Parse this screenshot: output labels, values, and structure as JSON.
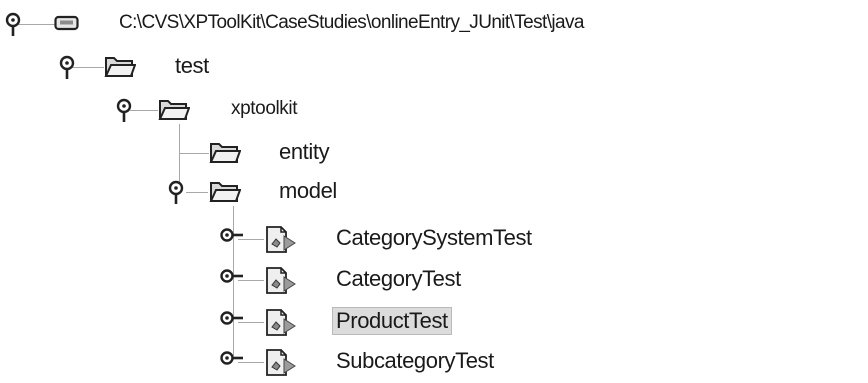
{
  "tree": {
    "root": {
      "label": "C:\\CVS\\XPToolKit\\CaseStudies\\onlineEntry_JUnit\\Test\\java",
      "icon": "drive-icon",
      "state": "expanded"
    },
    "nodes": [
      {
        "label": "test",
        "icon": "folder-icon",
        "state": "expanded"
      },
      {
        "label": "xptoolkit",
        "icon": "folder-icon",
        "state": "expanded"
      },
      {
        "label": "entity",
        "icon": "folder-icon",
        "state": "leaf"
      },
      {
        "label": "model",
        "icon": "folder-icon",
        "state": "expanded"
      },
      {
        "label": "CategorySystemTest",
        "icon": "test-class-icon",
        "state": "collapsed"
      },
      {
        "label": "CategoryTest",
        "icon": "test-class-icon",
        "state": "collapsed"
      },
      {
        "label": "ProductTest",
        "icon": "test-class-icon",
        "state": "collapsed",
        "selected": true
      },
      {
        "label": "SubcategoryTest",
        "icon": "test-class-icon",
        "state": "collapsed"
      }
    ]
  },
  "colors": {
    "selection_background": "#dcdcdc",
    "tree_line": "#a8a8a8",
    "text": "#1a1a1a"
  }
}
